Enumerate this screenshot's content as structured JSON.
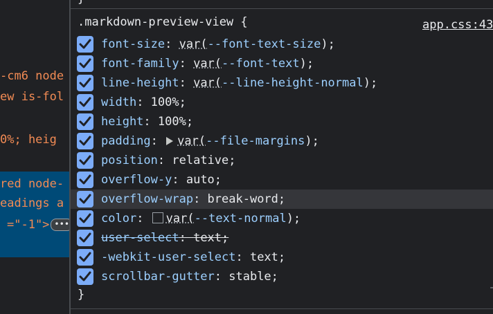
{
  "elements_panel": {
    "lines": [
      "-cm6 node",
      "ew is-fol",
      "0%; heig"
    ],
    "selected_lines": [
      "red node-",
      "eadings a"
    ],
    "selected_last_line": "=\"-1\">",
    "ellipsis_badge": "•••"
  },
  "styles_panel": {
    "top_fragment": "}",
    "selector": ".markdown-preview-view {",
    "source": "app.css:43",
    "closing_brace": "}",
    "corner_mark": "ˉ",
    "properties": [
      {
        "name": "font-size",
        "value_parts": [
          "var(",
          "--font-text-size",
          ");"
        ],
        "checked": true
      },
      {
        "name": "font-family",
        "value_parts": [
          "var(",
          "--font-text",
          ");"
        ],
        "checked": true
      },
      {
        "name": "line-height",
        "value_parts": [
          "var(",
          "--line-height-normal",
          ");"
        ],
        "checked": true
      },
      {
        "name": "width",
        "value": "100%;",
        "checked": true
      },
      {
        "name": "height",
        "value": "100%;",
        "checked": true
      },
      {
        "name": "padding",
        "value_parts": [
          "var(",
          "--file-margins",
          ");"
        ],
        "expandable": true,
        "checked": true
      },
      {
        "name": "position",
        "value": "relative;",
        "checked": true
      },
      {
        "name": "overflow-y",
        "value": "auto;",
        "checked": true
      },
      {
        "name": "overflow-wrap",
        "value": "break-word;",
        "checked": true,
        "highlighted": true
      },
      {
        "name": "color",
        "value_parts": [
          "var(",
          "--text-normal",
          ");"
        ],
        "swatch": "#202124",
        "checked": true
      },
      {
        "name": "user-select",
        "value": "text;",
        "checked": true,
        "overridden": true
      },
      {
        "name": "-webkit-user-select",
        "value": "text;",
        "checked": true
      },
      {
        "name": "scrollbar-gutter",
        "value": "stable;",
        "checked": true
      }
    ]
  },
  "colors": {
    "background": "#202124",
    "property_name": "#9ccffe",
    "checkbox": "#7cacf8",
    "dom_text": "#f28b54",
    "selected_row": "#004a77",
    "highlight_row": "#35363a"
  }
}
